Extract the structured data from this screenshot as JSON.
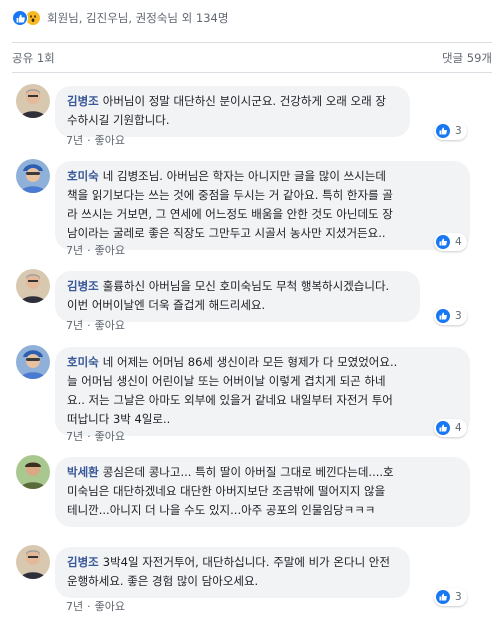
{
  "reactions": {
    "text": "회원님, 김진우님, 권정숙님 외 134명",
    "icons": [
      "like-icon",
      "wow-icon"
    ]
  },
  "stats": {
    "shares": "공유 1회",
    "comments": "댓글 59개"
  },
  "comments": [
    {
      "author": "김병조",
      "text": "아버님이 정말 대단하신 분이시군요. 건강하게 오래 오래 장\n수하시길 기원합니다.",
      "time": "7년",
      "like_label": "좋아요",
      "reaction_count": "3"
    },
    {
      "author": "호미숙",
      "text": "네 김병조님. 아버님은 학자는 아니지만 글을 많이 쓰시는데\n책을 읽기보다는 쓰는 것에 중점을 두시는 거 같아요. 특히 한자를 골\n라 쓰시는 거보면, 그 연세에 어느정도 배움을 안한 것도 아닌데도 장\n남이라는 굴레로 좋은 직장도 그만두고 시골서 농사만 지셨거든요..",
      "time": "7년",
      "like_label": "좋아요",
      "reaction_count": "4"
    },
    {
      "author": "김병조",
      "text": "훌륭하신 아버님을 모신 호미숙님도 무척 행복하시겠습니다.\n이번 어버이날엔 더욱 즐겁게 해드리세요.",
      "time": "7년",
      "like_label": "좋아요",
      "reaction_count": "3"
    },
    {
      "author": "호미숙",
      "text": "네 어제는 어머님 86세 생신이라 모든 형제가 다 모였었어요..\n늘 어머님 생신이 어린이날 또는 어버이날 이렇게 겹치게 되곤 하네\n요.. 저는 그날은 아마도 외부에 있을거 같네요 내일부터 자전거 투어\n떠납니다 3박 4일로..",
      "time": "7년",
      "like_label": "좋아요",
      "reaction_count": "4"
    },
    {
      "author": "박세환",
      "text": "콩심은데 콩나고... 특히 딸이 아버질 그대로 베낀다는데....호\n미숙님은 대단하겠네요 대단한 아버지보단 조금밖에 떨어지지 않을\n테니깐...아니지 더 나을 수도 있지...아주 공포의 인물임당ㅋㅋㅋ",
      "time": "7년",
      "like_label": "좋아요",
      "reaction_count": ""
    },
    {
      "author": "김병조",
      "text": "3박4일 자전거투어, 대단하십니다. 주말에 비가 온다니 안전\n운행하세요. 좋은 경험 많이 담아오세요.",
      "time": "7년",
      "like_label": "좋아요",
      "reaction_count": "3"
    }
  ]
}
